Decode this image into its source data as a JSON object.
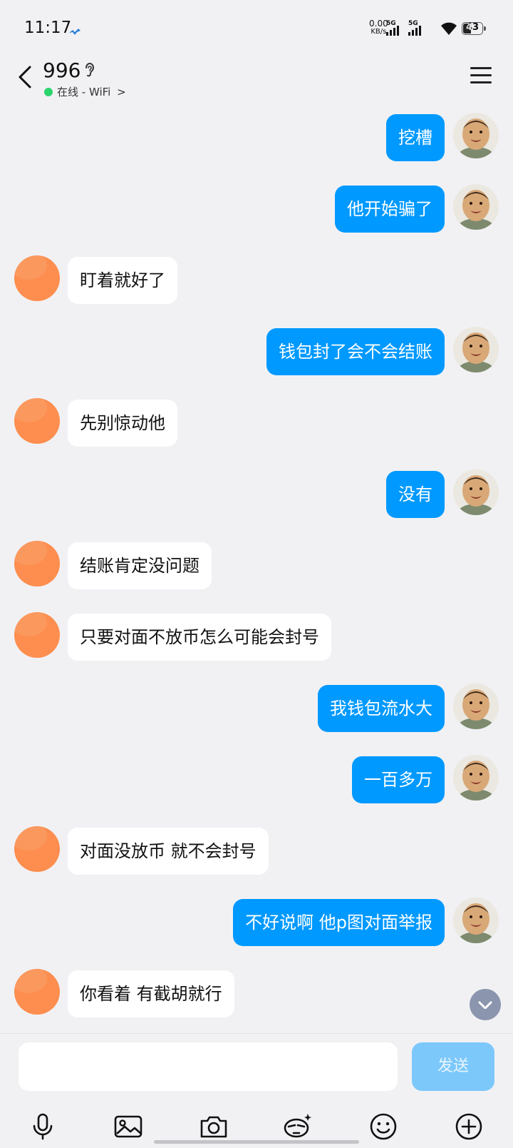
{
  "status_bar": {
    "time": "11:17",
    "net_speed_value": "0.00",
    "net_speed_unit": "KB/s",
    "sim1_label": "5G",
    "sim2_label": "5G",
    "battery": "43"
  },
  "header": {
    "contact_name": "996",
    "presence": "在线 - WiFi",
    "presence_arrow": ">"
  },
  "messages": [
    {
      "from": "me",
      "text": "挖槽"
    },
    {
      "from": "me",
      "text": "他开始骗了"
    },
    {
      "from": "them",
      "text": "盯着就好了"
    },
    {
      "from": "me",
      "text": "钱包封了会不会结账"
    },
    {
      "from": "them",
      "text": "先别惊动他"
    },
    {
      "from": "me",
      "text": "没有"
    },
    {
      "from": "them",
      "text": "结账肯定没问题"
    },
    {
      "from": "them",
      "text": "只要对面不放币怎么可能会封号"
    },
    {
      "from": "me",
      "text": "我钱包流水大"
    },
    {
      "from": "me",
      "text": "一百多万"
    },
    {
      "from": "them",
      "text": "对面没放币 就不会封号"
    },
    {
      "from": "me",
      "text": "不好说啊 他p图对面举报"
    },
    {
      "from": "them",
      "text": "你看着 有截胡就行"
    }
  ],
  "composer": {
    "input_value": "",
    "send_label": "发送"
  },
  "toolbar": {
    "icons": [
      "microphone-icon",
      "image-icon",
      "camera-icon",
      "ai-assistant-icon",
      "emoji-icon",
      "plus-icon"
    ]
  },
  "colors": {
    "outgoing_bubble": "#0099ff",
    "incoming_bubble": "#ffffff",
    "background": "#f1f1f4",
    "send_button": "#7cc8fb",
    "online_dot": "#2bd46d",
    "contact_avatar": "#fd8e4f"
  }
}
